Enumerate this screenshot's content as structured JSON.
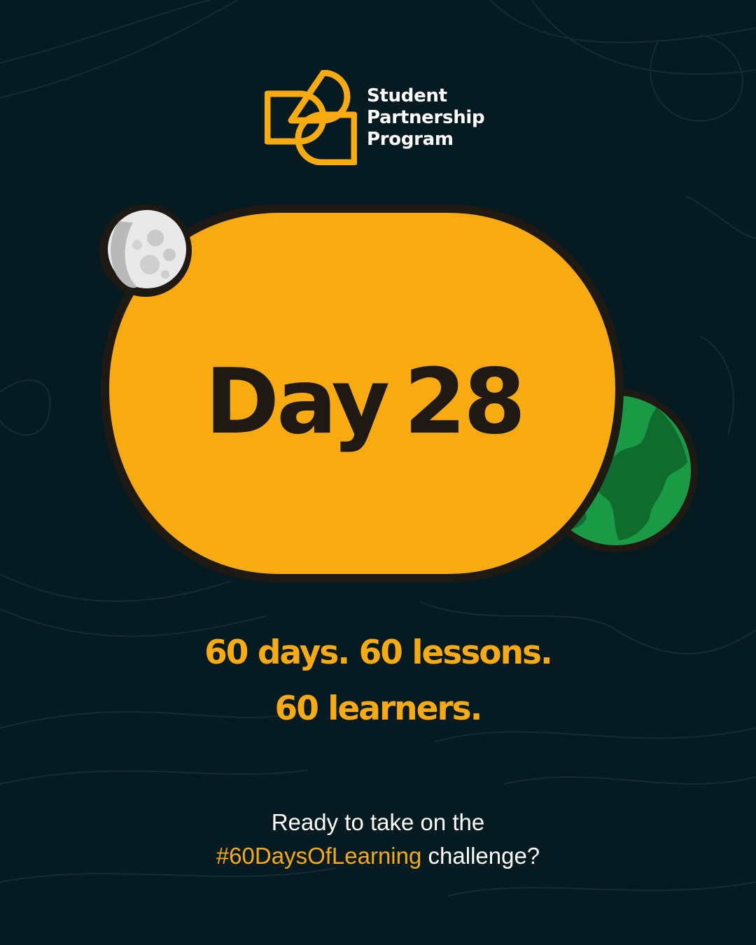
{
  "logo": {
    "line1": "Student",
    "line2": "Partnership",
    "line3": "Program"
  },
  "hero": {
    "word": "Day",
    "number": "28"
  },
  "tagline": {
    "line1": "60 days.  60 lessons.",
    "line2": "60 learners."
  },
  "cta": {
    "line1": "Ready to take on the",
    "hashtag": "#60DaysOfLearning",
    "tail": " challenge?"
  },
  "colors": {
    "background": "#061a22",
    "accent_yellow": "#f7ab11",
    "globe_green": "#1a9a45",
    "outline": "#1e1a13"
  },
  "icons": [
    "spp-logo-icon",
    "moon-icon",
    "earth-globe-icon"
  ]
}
